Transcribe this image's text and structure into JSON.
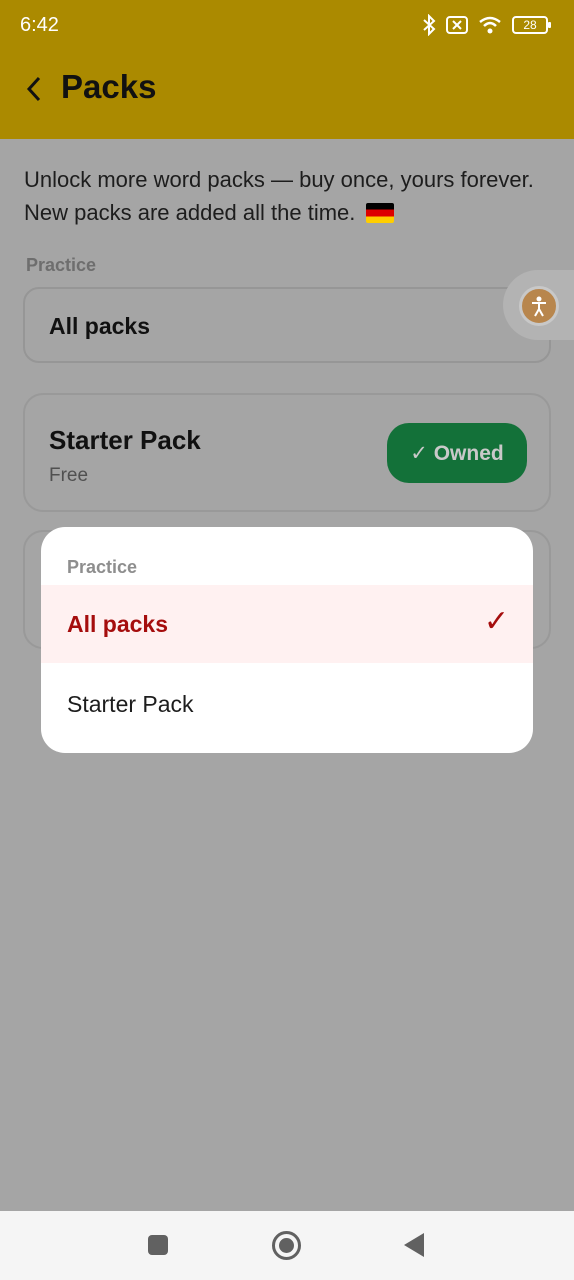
{
  "status_bar": {
    "time": "6:42",
    "battery": "28"
  },
  "header": {
    "title": "Packs"
  },
  "intro": {
    "text": "Unlock more word packs — buy once, yours forever. New packs are added all the time."
  },
  "practice": {
    "label": "Practice",
    "selected": "All packs"
  },
  "packs": [
    {
      "name": "Starter Pack",
      "price": "Free",
      "action": "✓ Owned"
    }
  ],
  "popup": {
    "title": "Practice",
    "options": [
      {
        "label": "All packs",
        "selected": true
      },
      {
        "label": "Starter Pack",
        "selected": false
      }
    ],
    "check": "✓"
  },
  "colors": {
    "header_bg": "#ab8a00",
    "owned_green": "#137139",
    "selected_red": "#a50d0d",
    "selected_bg": "#fff1f1"
  },
  "icons": [
    "back-arrow-icon",
    "bluetooth-icon",
    "sim-off-icon",
    "wifi-icon",
    "battery-icon",
    "accessibility-icon",
    "check-icon",
    "german-flag-icon"
  ]
}
